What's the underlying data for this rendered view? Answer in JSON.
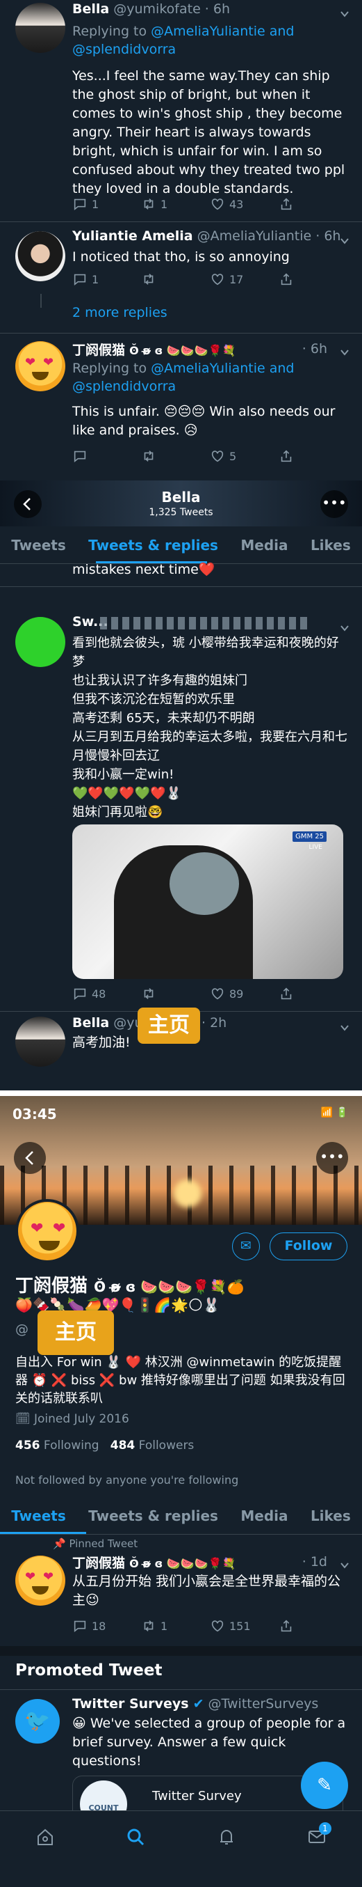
{
  "tweet1": {
    "name": "Bella",
    "handle": "@yumikofate",
    "time": "6h",
    "replying_label": "Replying to",
    "replying_to": "@AmeliaYuliantie and @splendidvorra",
    "text": "Yes...I feel the same way.They can ship the ghost ship of bright,  but when it comes to win's ghost ship ,  they become angry. Their heart is always towards bright, which is unfair for win. I am so confused about why they treated two ppl they loved in a double standards.",
    "replies": "1",
    "retweets": "1",
    "likes": "43"
  },
  "tweet2": {
    "name": "Yuliantie Amelia",
    "handle": "@AmeliaYuliantie",
    "time": "6h",
    "text": "I noticed that tho, is so annoying",
    "replies": "1",
    "retweets": "",
    "likes": "17"
  },
  "more_replies": "2 more replies",
  "tweet3": {
    "name": "丁阏假猫",
    "name_emojis": "ʘ̆ ʚ̴̶̷ ɞ 🍉🍉🍉🌹💐",
    "time": "6h",
    "replying_label": "Replying to",
    "replying_to": "@AmeliaYuliantie and @splendidvorra",
    "text": "This is unfair. 😔😔😔 Win also needs our like and praises. 😥",
    "likes": "5"
  },
  "profile_bar": {
    "name": "Bella",
    "tweet_count": "1,325 Tweets",
    "tabs": [
      "Tweets",
      "Tweets & replies",
      "Media",
      "Likes"
    ],
    "active_tab": "Tweets & replies"
  },
  "partial_text": "mistakes next time❤️",
  "tweet4": {
    "name": "Sw...",
    "lines": "看到他就会彼头，琥 小樱带给我幸运和夜晚的好梦\n也让我认识了许多有趣的姐妹门\n但我不该沉沦在短暂的欢乐里\n高考还剩 65天，未来却仍不明朗\n从三月到五月给我的幸运太多啦，我要在六月和七月慢慢补回去辽\n我和小嬴一定win!\n💚❤️💚❤️💚❤️🐰\n姐妹门再见啦🤓",
    "replies": "48",
    "retweets": "",
    "likes": "89",
    "video_badge": "GMM 25",
    "video_live": "LIVE"
  },
  "badge_main": "主页",
  "tweet5": {
    "name": "Bella",
    "handle": "@yumi",
    "time": "2h",
    "text": "高考加油!"
  },
  "status_time": "03:45",
  "profile": {
    "name": "丁阏假猫",
    "name_emojis": "ʘ̆ ʚ̴̶̷ ɞ 🍉🍉🍉🌹💐🍊",
    "emoji_row": "🍑🍫🍡🍆🥭💖🎈🚦🌈🌟🌕🐰",
    "handle": "@",
    "bio": "自出入 For win 🐰 ❤️ 林汉洲 @winmetawin 的吃饭提醒器 ⏰ ❌ biss ❌ bw 推特好像哪里出了问题 如果我没有回关的话就联系叭",
    "bio_mention": "@winmetawin",
    "joined": "Joined July 2016",
    "following_count": "456",
    "following_label": "Following",
    "followers_count": "484",
    "followers_label": "Followers",
    "not_followed": "Not followed by anyone you're following",
    "follow_button": "Follow",
    "tabs": [
      "Tweets",
      "Tweets & replies",
      "Media",
      "Likes"
    ],
    "active_tab": "Tweets"
  },
  "pinned": {
    "label": "Pinned Tweet",
    "name": "丁阏假猫",
    "name_emojis": "ʘ̆ ʚ̴̶̷ ɞ 🍉🍉🍉🌹💐",
    "time": "1d",
    "text": "从五月份开始 我们小嬴会是全世界最幸福的公主😉",
    "replies": "18",
    "retweets": "1",
    "likes": "151"
  },
  "promoted": {
    "header": "Promoted Tweet",
    "name": "Twitter Surveys",
    "handle": "@TwitterSurveys",
    "text": "😀 We've selected a group of people for a brief survey.  Answer a few quick questions!",
    "card_title": "Twitter Survey",
    "card_logo_text": "COUNT"
  },
  "nav_badge": "1",
  "colors": {
    "accent": "#1da1f2",
    "bg": "#15202b",
    "muted": "#8899a6",
    "badge": "#e8a31b"
  }
}
